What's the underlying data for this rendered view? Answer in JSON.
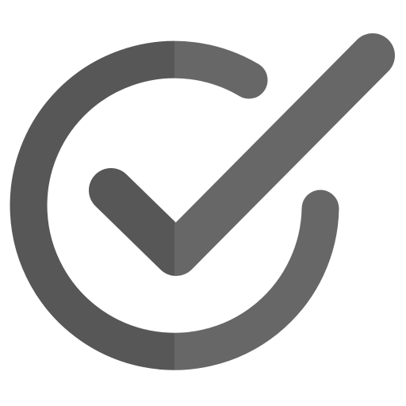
{
  "icon": {
    "name": "check-circle-icon",
    "colors": {
      "dark": "#575757",
      "light": "#676767",
      "background": "#ffffff"
    }
  }
}
